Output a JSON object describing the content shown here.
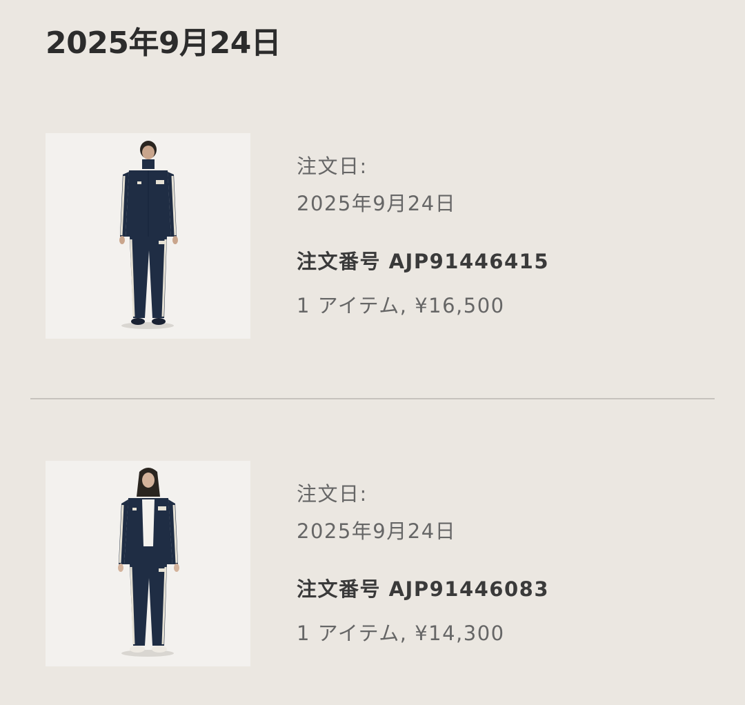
{
  "page": {
    "title": "2025年9月24日"
  },
  "orders": [
    {
      "date_label": "注文日:",
      "date_value": "2025年9月24日",
      "order_number": "注文番号 AJP91446415",
      "items_summary": "1 アイテム, ¥16,500",
      "image": {
        "description_icon": "product-photo-icon",
        "jacket_color": "#1f2d44",
        "stripe_color": "#e6e1d4"
      }
    },
    {
      "date_label": "注文日:",
      "date_value": "2025年9月24日",
      "order_number": "注文番号 AJP91446083",
      "items_summary": "1 アイテム, ¥14,300",
      "image": {
        "description_icon": "product-photo-icon",
        "jacket_color": "#1f2d44",
        "stripe_color": "#e6e1d4"
      }
    }
  ],
  "colors": {
    "background": "#ebe7e1",
    "thumbnail_bg": "#f3f1ee",
    "divider": "#c6c2bd",
    "text_primary": "#2c2c2c",
    "text_secondary": "#666666"
  }
}
